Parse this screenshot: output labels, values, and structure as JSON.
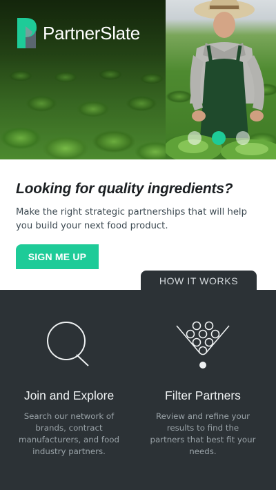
{
  "brand": {
    "name": "PartnerSlate",
    "accent_color": "#1ecb98",
    "logo_icon": "partnerslate-logo-icon"
  },
  "hero": {
    "carousel": {
      "slide_count": 3,
      "active_index": 1
    }
  },
  "intro": {
    "headline": "Looking for quality ingredients?",
    "subtext": "Make the right strategic partnerships that will help you build your next food product.",
    "cta_label": "SIGN ME UP"
  },
  "how_it_works": {
    "tab_label": "HOW IT WORKS",
    "background_color": "#2c3236",
    "features": [
      {
        "icon": "magnifying-glass-icon",
        "title": "Join and Explore",
        "description": "Search our network of brands, contract manufacturers, and food industry partners."
      },
      {
        "icon": "funnel-filter-icon",
        "title": "Filter Partners",
        "description": "Review and refine your results to find the partners that best fit your needs."
      }
    ]
  }
}
